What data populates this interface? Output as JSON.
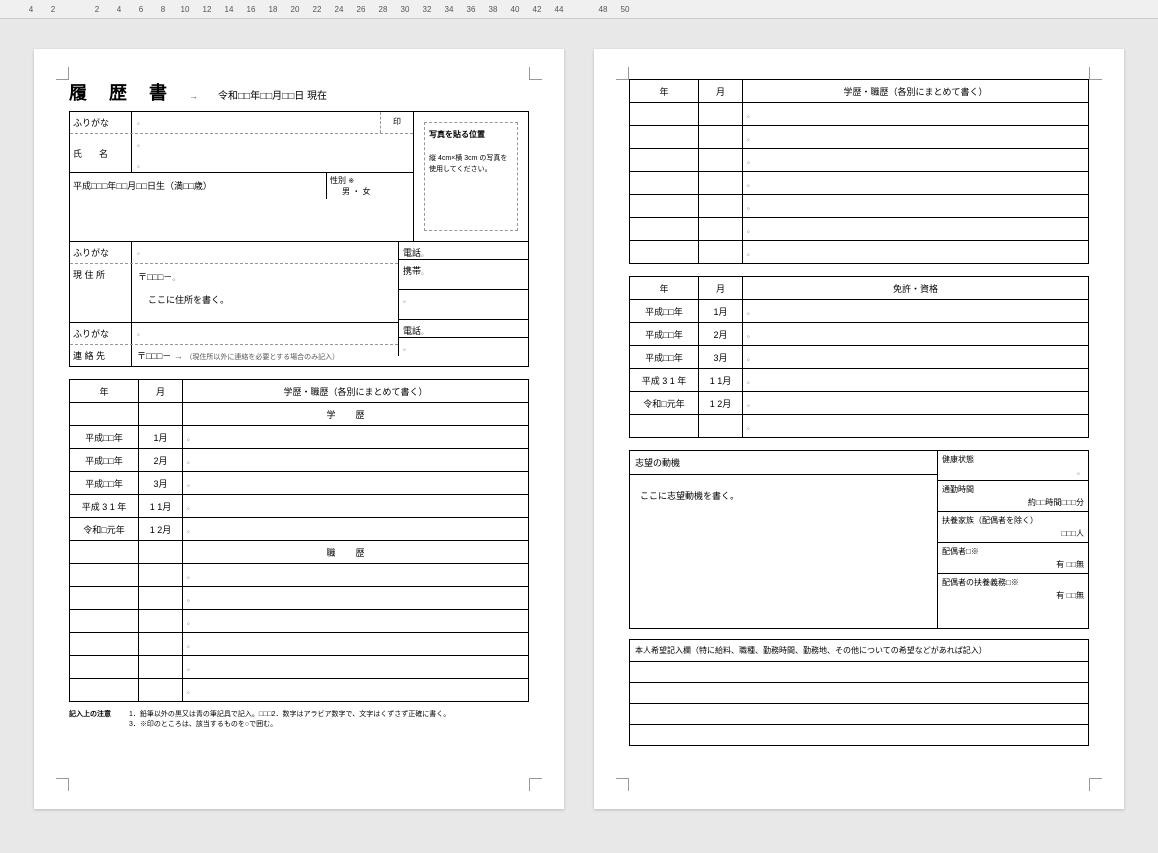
{
  "ruler_marks": [
    "4",
    "2",
    "",
    "2",
    "4",
    "6",
    "8",
    "10",
    "12",
    "14",
    "16",
    "18",
    "20",
    "22",
    "24",
    "26",
    "28",
    "30",
    "32",
    "34",
    "36",
    "38",
    "40",
    "42",
    "44",
    "",
    "48",
    "50"
  ],
  "title": "履　歴　書",
  "date_line": "令和□□年□□月□□日 現在",
  "labels": {
    "furigana": "ふりがな",
    "name": "氏　名",
    "stamp": "印",
    "dob": "平成□□□年□□月□□日生（満□□歳）",
    "gender_label": "性別",
    "gender_note": "※",
    "gender_val": "男 ・ 女",
    "address": "現 住 所",
    "postal": "〒□□□－",
    "addr_body": "ここに住所を書く。",
    "contact": "連 絡 先",
    "contact_note": "（現住所以外に連絡を必要とする場合のみ記入）",
    "phone": "電話",
    "mobile": "携帯"
  },
  "photo": {
    "title": "写真を貼る位置",
    "body": "縦 4cm×横 3cm の写真を使用してください。"
  },
  "history_hdr": {
    "year": "年",
    "month": "月",
    "title": "学歴・職歴（各別にまとめて書く）"
  },
  "section_edu": "学歴",
  "section_work": "職歴",
  "rows_p1": [
    {
      "y": "平成□□年",
      "m": "1月",
      "v": ""
    },
    {
      "y": "平成□□年",
      "m": "2月",
      "v": ""
    },
    {
      "y": "平成□□年",
      "m": "3月",
      "v": ""
    },
    {
      "y": "平成 3 1 年",
      "m": "1 1月",
      "v": ""
    },
    {
      "y": "令和□元年",
      "m": "1 2月",
      "v": ""
    }
  ],
  "footnote_label": "記入上の注意",
  "footnote": "1．鉛筆以外の黒又は青の筆記具で記入。□□□2．数字はアラビア数字で、文字はくずさず正確に書く。\n3．※印のところは、該当するものを○で囲む。",
  "license_hdr": {
    "year": "年",
    "month": "月",
    "title": "免許・資格"
  },
  "rows_lic": [
    {
      "y": "平成□□年",
      "m": "1月",
      "v": ""
    },
    {
      "y": "平成□□年",
      "m": "2月",
      "v": ""
    },
    {
      "y": "平成□□年",
      "m": "3月",
      "v": ""
    },
    {
      "y": "平成 3 1 年",
      "m": "1 1月",
      "v": ""
    },
    {
      "y": "令和□元年",
      "m": "1 2月",
      "v": ""
    }
  ],
  "motive": {
    "label": "志望の動機",
    "body": "ここに志望動機を書く。"
  },
  "side": {
    "health": "健康状態",
    "commute": "通勤時間",
    "commute_v": "約□□時間□□□分",
    "dependents": "扶養家族（配偶者を除く）",
    "dependents_v": "□□□人",
    "spouse": "配偶者□※",
    "spouse_v": "有 □□無",
    "spouse_dep": "配偶者の扶養義務□※",
    "spouse_dep_v": "有 □□無"
  },
  "wish_label": "本人希望記入欄（特に給料、職種、勤務時間、勤務地、その他についての希望などがあれば記入）"
}
